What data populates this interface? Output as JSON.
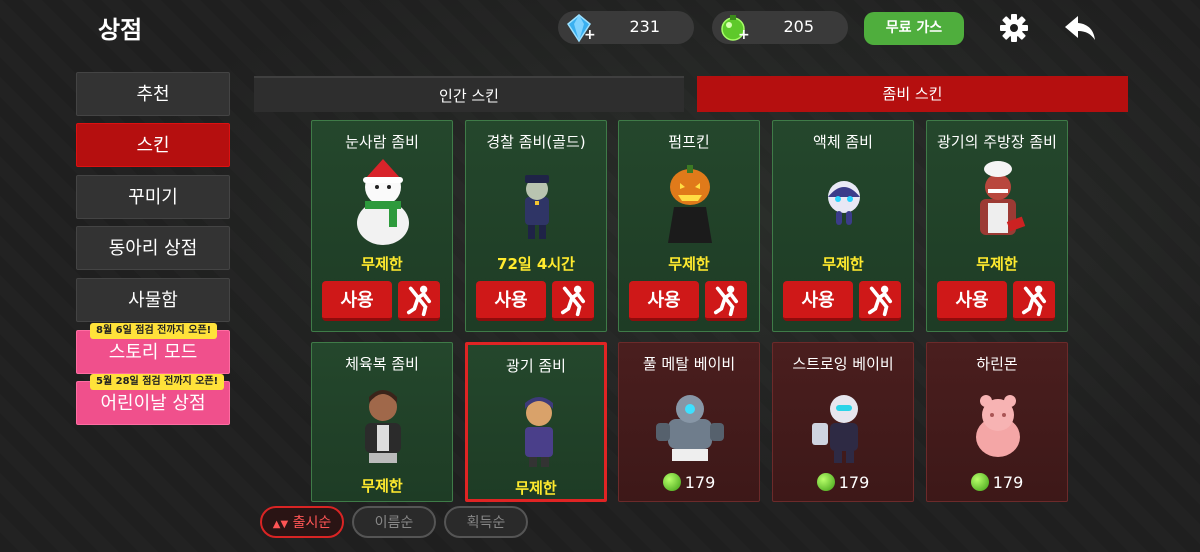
{
  "header": {
    "title": "상점",
    "gems": "231",
    "coins": "205",
    "free_gas_label": "무료 가스"
  },
  "sidebar": {
    "items": [
      {
        "label": "추천"
      },
      {
        "label": "스킨"
      },
      {
        "label": "꾸미기"
      },
      {
        "label": "동아리 상점"
      },
      {
        "label": "사물함"
      },
      {
        "label": "스토리 모드",
        "tag": "8월 6일 점검 전까지 오픈!"
      },
      {
        "label": "어린이날 상점",
        "tag": "5월 28일 점검 전까지 오픈!"
      }
    ]
  },
  "tabs": {
    "human": "인간 스킨",
    "zombie": "좀비 스킨"
  },
  "cards": [
    {
      "name": "눈사람 좀비",
      "status": "무제한",
      "use": "사용"
    },
    {
      "name": "경찰 좀비(골드)",
      "status": "72일 4시간",
      "use": "사용"
    },
    {
      "name": "펌프킨",
      "status": "무제한",
      "use": "사용"
    },
    {
      "name": "액체 좀비",
      "status": "무제한",
      "use": "사용"
    },
    {
      "name": "광기의 주방장 좀비",
      "status": "무제한",
      "use": "사용"
    },
    {
      "name": "체육복 좀비",
      "status": "무제한"
    },
    {
      "name": "광기 좀비",
      "status": "무제한"
    },
    {
      "name": "풀 메탈 베이비",
      "price": "179"
    },
    {
      "name": "스트로잉 베이비",
      "price": "179"
    },
    {
      "name": "하린몬",
      "price": "179"
    }
  ],
  "sort": {
    "release": "출시순",
    "name": "이름순",
    "acquired": "획득순"
  },
  "colors": {
    "accent_red": "#b50f0f",
    "free_green": "#4fae3d",
    "owned_green": "#24472c",
    "locked_red": "#4a1e1e",
    "duration_yellow": "#ffea2e"
  }
}
